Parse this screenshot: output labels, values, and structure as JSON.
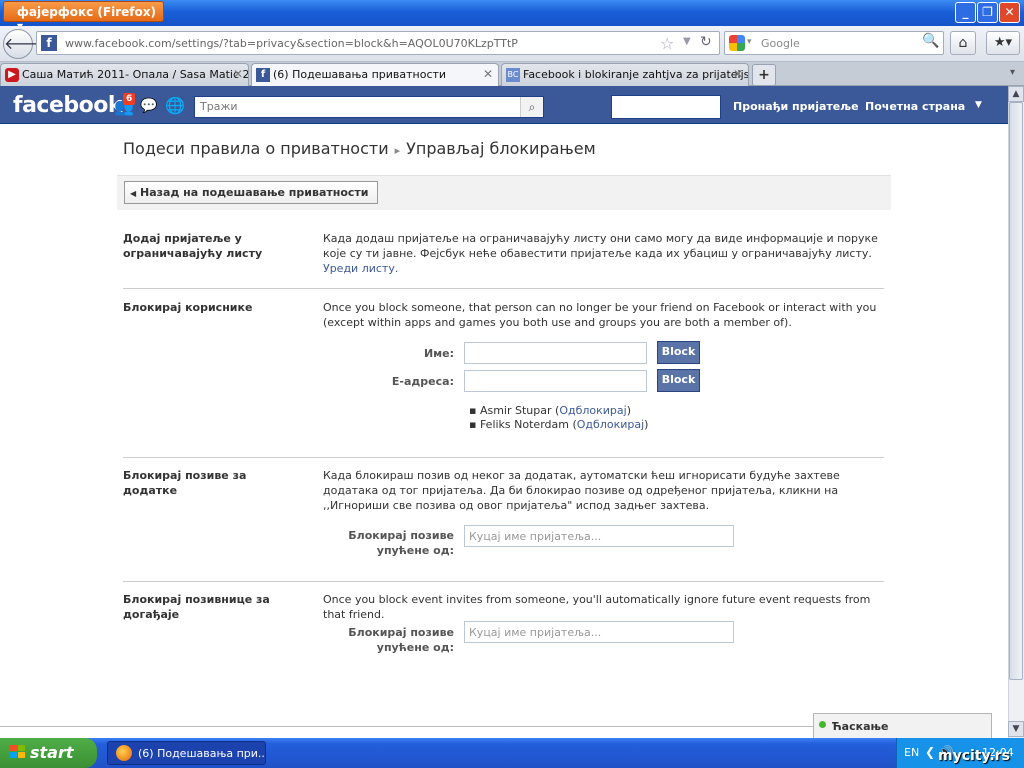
{
  "browser": {
    "menu_button": "фајерфокс (Firefox)",
    "url": "www.facebook.com/settings/?tab=privacy&section=block&h=AQOL0U70KLzpTTtP",
    "search_placeholder": "Google",
    "tabs": [
      {
        "label": "Саша Матић 2011- Опала / Sasa Matic 2...",
        "icon": "youtube-icon",
        "active": false
      },
      {
        "label": "(6) Подешавања приватности",
        "icon": "facebook-icon",
        "active": true
      },
      {
        "label": "Facebook i blokiranje zahtjva za prijateljs...",
        "icon": "site-icon",
        "active": false
      }
    ],
    "new_tab": "+"
  },
  "fb_header": {
    "logo": "facebook",
    "notifications_count": "6",
    "search_placeholder": "Тражи",
    "find_friends": "Пронађи пријатеље",
    "home": "Почетна страна"
  },
  "page": {
    "breadcrumb_root": "Подеси правила о приватности",
    "breadcrumb_sep": "▸",
    "breadcrumb_current": "Управљај блокирањем",
    "back_button": "Назад на подешавање приватности"
  },
  "sections": {
    "restricted": {
      "label": "Додај пријатеље у ограничавајућу листу",
      "text": "Када додаш пријатеље на ограничавајућу листу они само могу да виде информације и поруке које су ти јавне. Фејсбук неће обавестити пријатеље када их убациш у ограничавајућу листу.",
      "link": "Уреди листу."
    },
    "block_users": {
      "label": "Блокирај кориснике",
      "text": "Once you block someone, that person can no longer be your friend on Facebook or interact with you (except within apps and games you both use and groups you are both a member of).",
      "name_label": "Име:",
      "email_label": "Е-адреса:",
      "block_button": "Block",
      "blocked": [
        {
          "name": "Asmir Stupar",
          "action": "Одблокирај"
        },
        {
          "name": "Feliks Noterdam",
          "action": "Одблокирај"
        }
      ]
    },
    "app_invites": {
      "label": "Блокирај позиве за додатке",
      "text": "Када блокираш позив од неког за додатак, аутоматски ћеш игнорисати будуће захтеве додатака од тог пријатеља. Да би блокирао позиве од одређеног пријатеља, кликни на ,,Игнориши све позива од овог пријатеља\" испод задњег захтева.",
      "field_label": "Блокирај позиве упућене од:",
      "placeholder": "Куцај име пријатеља..."
    },
    "event_invites": {
      "label": "Блокирај позивнице за догађаје",
      "text": "Once you block event invites from someone, you'll automatically ignore future event requests from that friend.",
      "field_label": "Блокирај позиве упућене од:",
      "placeholder": "Куцај име пријатеља..."
    }
  },
  "chat": {
    "label": "Ћаскање"
  },
  "taskbar": {
    "start": "start",
    "task": "(6) Подешавања при...",
    "lang": "EN",
    "clock": "12:04",
    "watermark": "mycity.rs"
  },
  "colors": {
    "fb_blue": "#3b5998",
    "button_blue": "#5b74a8",
    "link": "#3b5998"
  }
}
